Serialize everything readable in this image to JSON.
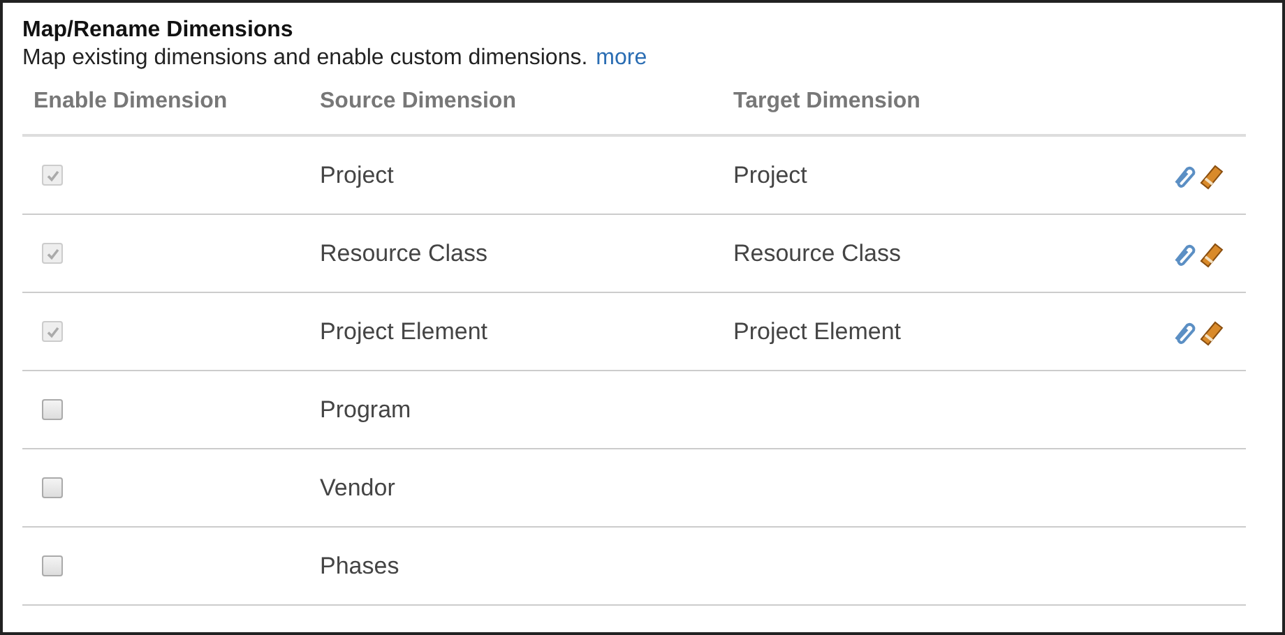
{
  "title": "Map/Rename Dimensions",
  "description": "Map existing dimensions and enable custom dimensions.",
  "more_link": "more",
  "table": {
    "columns": [
      "Enable Dimension",
      "Source Dimension",
      "Target Dimension"
    ],
    "rows": [
      {
        "checked": true,
        "disabled": true,
        "source": "Project",
        "target": "Project",
        "actions": true
      },
      {
        "checked": true,
        "disabled": true,
        "source": "Resource Class",
        "target": "Resource Class",
        "actions": true
      },
      {
        "checked": true,
        "disabled": true,
        "source": "Project Element",
        "target": "Project Element",
        "actions": true
      },
      {
        "checked": false,
        "disabled": false,
        "source": "Program",
        "actions": false
      },
      {
        "checked": false,
        "disabled": false,
        "source": "Vendor",
        "actions": false
      },
      {
        "checked": false,
        "disabled": false,
        "source": "Phases",
        "actions": false
      }
    ]
  }
}
